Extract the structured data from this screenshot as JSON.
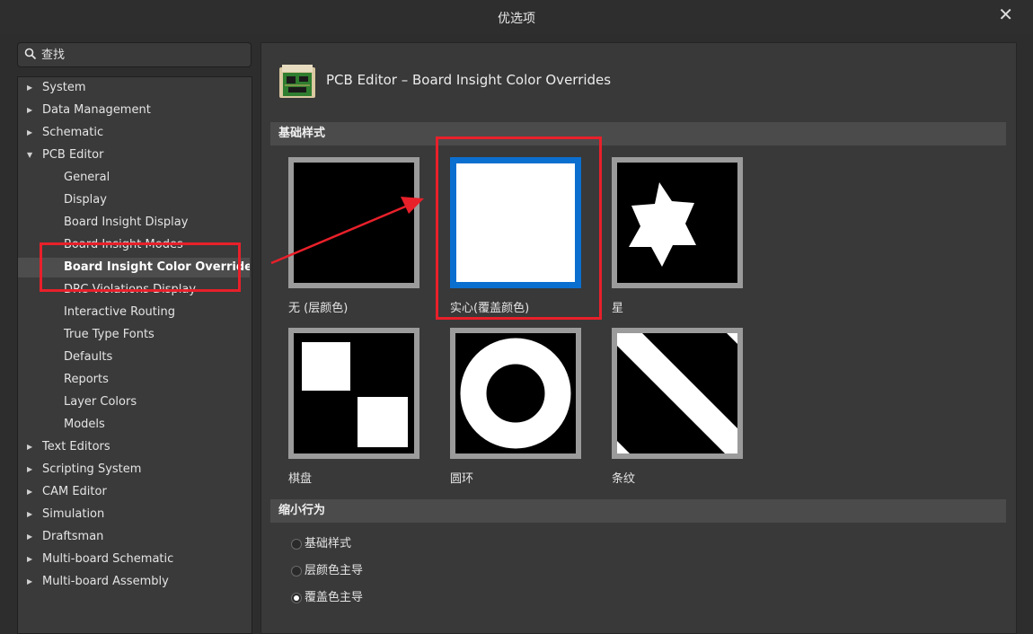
{
  "window": {
    "title": "优选项",
    "close_glyph": "✕"
  },
  "search": {
    "placeholder": "查找",
    "icon": "search-icon"
  },
  "tree": [
    {
      "label": "System",
      "level": 0,
      "expandable": true,
      "expanded": false
    },
    {
      "label": "Data Management",
      "level": 0,
      "expandable": true,
      "expanded": false
    },
    {
      "label": "Schematic",
      "level": 0,
      "expandable": true,
      "expanded": false
    },
    {
      "label": "PCB Editor",
      "level": 0,
      "expandable": true,
      "expanded": true
    },
    {
      "label": "General",
      "level": 1
    },
    {
      "label": "Display",
      "level": 1
    },
    {
      "label": "Board Insight Display",
      "level": 1
    },
    {
      "label": "Board Insight Modes",
      "level": 1
    },
    {
      "label": "Board Insight Color Overrides",
      "level": 1,
      "selected": true
    },
    {
      "label": "DRC Violations Display",
      "level": 1
    },
    {
      "label": "Interactive Routing",
      "level": 1
    },
    {
      "label": "True Type Fonts",
      "level": 1
    },
    {
      "label": "Defaults",
      "level": 1
    },
    {
      "label": "Reports",
      "level": 1
    },
    {
      "label": "Layer Colors",
      "level": 1
    },
    {
      "label": "Models",
      "level": 1
    },
    {
      "label": "Text Editors",
      "level": 0,
      "expandable": true,
      "expanded": false
    },
    {
      "label": "Scripting System",
      "level": 0,
      "expandable": true,
      "expanded": false
    },
    {
      "label": "CAM Editor",
      "level": 0,
      "expandable": true,
      "expanded": false
    },
    {
      "label": "Simulation",
      "level": 0,
      "expandable": true,
      "expanded": false
    },
    {
      "label": "Draftsman",
      "level": 0,
      "expandable": true,
      "expanded": false
    },
    {
      "label": "Multi-board Schematic",
      "level": 0,
      "expandable": true,
      "expanded": false
    },
    {
      "label": "Multi-board Assembly",
      "level": 0,
      "expandable": true,
      "expanded": false
    }
  ],
  "page": {
    "title": "PCB Editor – Board Insight Color Overrides",
    "icon": "pcb-board-icon",
    "base_pattern": {
      "heading": "基础样式",
      "tiles": [
        {
          "label": "无 (层颜色)",
          "pattern": "none"
        },
        {
          "label": "实心(覆盖颜色)",
          "pattern": "solid",
          "selected": true
        },
        {
          "label": "星",
          "pattern": "star"
        },
        {
          "label": "棋盘",
          "pattern": "checkerboard"
        },
        {
          "label": "圆环",
          "pattern": "ring"
        },
        {
          "label": "条纹",
          "pattern": "stripe"
        }
      ]
    },
    "zoom_behavior": {
      "heading": "缩小行为",
      "options": [
        {
          "label": "基础样式",
          "checked": false
        },
        {
          "label": "层颜色主导",
          "checked": false
        },
        {
          "label": "覆盖色主导",
          "checked": true
        }
      ]
    }
  },
  "annotations": {
    "highlight_color": "#e8202a"
  },
  "colors": {
    "accent": "#0b6fd0",
    "panel": "#393939",
    "tree_bg": "#3a3a3a"
  }
}
